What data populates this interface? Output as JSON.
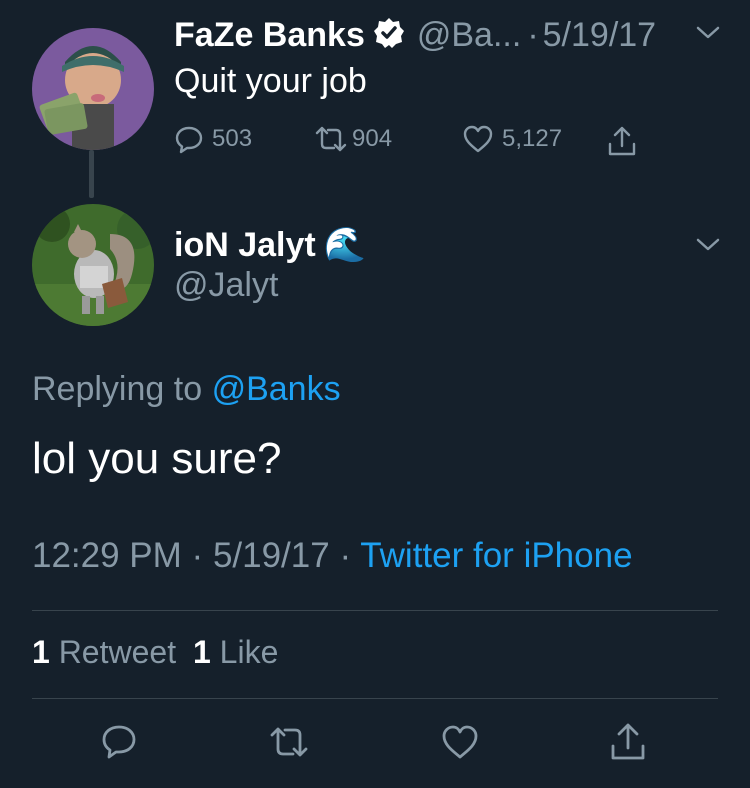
{
  "parent_tweet": {
    "display_name": "FaZe Banks",
    "handle": "@Ba...",
    "separator": "·",
    "date": "5/19/17",
    "text": "Quit your job",
    "reply_count": "503",
    "retweet_count": "904",
    "like_count": "5,127"
  },
  "main_tweet": {
    "display_name": "ioN Jalyt",
    "name_emoji": "🌊",
    "handle": "@Jalyt",
    "replying_prefix": "Replying to",
    "replying_handle": "@Banks",
    "text": "lol you sure?",
    "time": "12:29 PM",
    "separator1": "·",
    "date": "5/19/17",
    "separator2": "·",
    "source": "Twitter for iPhone",
    "retweets_num": "1",
    "retweets_label": "Retweet",
    "likes_num": "1",
    "likes_label": "Like"
  },
  "colors": {
    "background": "#15202b",
    "muted": "#8899a6",
    "accent": "#1da1f2",
    "divider": "#38444d"
  }
}
